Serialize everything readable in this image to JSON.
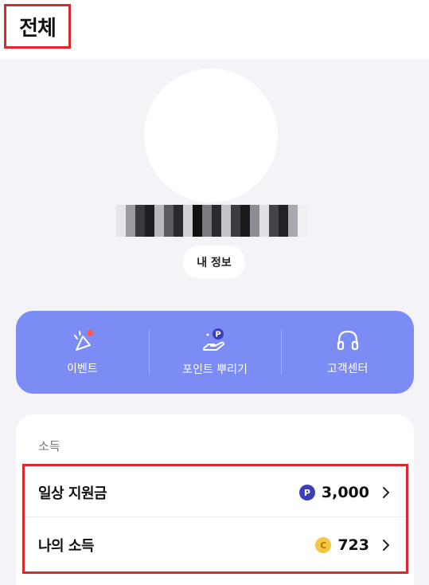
{
  "header": {
    "title": "전체"
  },
  "profile": {
    "my_info_label": "내 정보"
  },
  "quick_menu": {
    "items": [
      {
        "label": "이벤트",
        "icon": "party-popper-icon"
      },
      {
        "label": "포인트 뿌리기",
        "icon": "hand-point-icon"
      },
      {
        "label": "고객센터",
        "icon": "headset-icon"
      }
    ],
    "background": "#7b8df5"
  },
  "income": {
    "section_label": "소득",
    "rows": [
      {
        "label": "일상 지원금",
        "badge": "P",
        "value": "3,000"
      },
      {
        "label": "나의 소득",
        "badge": "C",
        "value": "723"
      }
    ]
  },
  "colors": {
    "highlight": "#e0262d",
    "point_badge": "#3d3fb8",
    "coin_badge": "#f5c642"
  }
}
